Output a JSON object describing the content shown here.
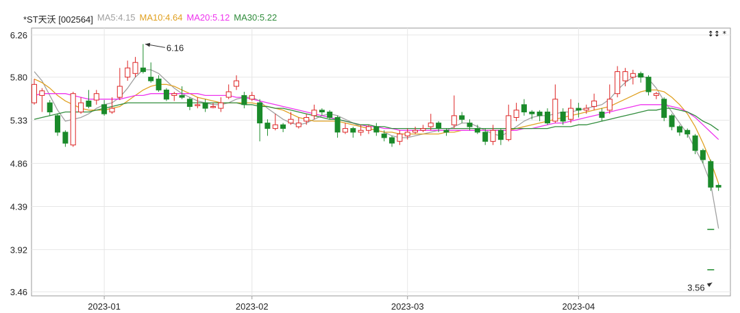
{
  "chart_data": {
    "type": "candlestick",
    "legend": [
      {
        "key": "title",
        "text": "*ST天沃 [002564]",
        "color": "#222222"
      },
      {
        "key": "ma5",
        "text": "MA5:4.15",
        "color": "#a0a0a0"
      },
      {
        "key": "ma10",
        "text": "MA10:4.64",
        "color": "#e0a020"
      },
      {
        "key": "ma20",
        "text": "MA20:5.12",
        "color": "#ee33ee"
      },
      {
        "key": "ma30",
        "text": "MA30:5.22",
        "color": "#2e8b3a"
      }
    ],
    "y_ticks": [
      "6.26",
      "5.80",
      "5.33",
      "4.86",
      "4.39",
      "3.92",
      "3.46"
    ],
    "ylim": [
      3.46,
      6.26
    ],
    "x_ticks": [
      {
        "label": "2023-01",
        "index": 9
      },
      {
        "label": "2023-02",
        "index": 28
      },
      {
        "label": "2023-03",
        "index": 48
      },
      {
        "label": "2023-04",
        "index": 70
      }
    ],
    "annotations": [
      {
        "text": "6.16",
        "index": 14,
        "value": 6.16
      },
      {
        "text": "3.56",
        "index": 87,
        "value": 3.56
      }
    ],
    "colors": {
      "up": "#dd2222",
      "down": "#1a8a2a",
      "grid": "#e6e6e6",
      "axis": "#999999"
    },
    "candles": [
      [
        5.52,
        5.72,
        5.78,
        5.5
      ],
      [
        5.6,
        5.65,
        5.68,
        5.42
      ],
      [
        5.52,
        5.42,
        5.55,
        5.38
      ],
      [
        5.38,
        5.2,
        5.4,
        5.16
      ],
      [
        5.2,
        5.08,
        5.22,
        5.04
      ],
      [
        5.06,
        5.62,
        5.64,
        5.04
      ],
      [
        5.42,
        5.52,
        5.58,
        5.4
      ],
      [
        5.54,
        5.48,
        5.66,
        5.46
      ],
      [
        5.55,
        5.62,
        5.66,
        5.5
      ],
      [
        5.5,
        5.4,
        5.55,
        5.38
      ],
      [
        5.42,
        5.46,
        5.58,
        5.4
      ],
      [
        5.58,
        5.7,
        5.9,
        5.55
      ],
      [
        5.8,
        5.9,
        5.98,
        5.76
      ],
      [
        5.84,
        5.96,
        6.02,
        5.8
      ],
      [
        5.9,
        5.86,
        6.16,
        5.84
      ],
      [
        5.8,
        5.76,
        5.96,
        5.74
      ],
      [
        5.78,
        5.66,
        5.82,
        5.64
      ],
      [
        5.66,
        5.56,
        5.68,
        5.54
      ],
      [
        5.6,
        5.62,
        5.64,
        5.54
      ],
      [
        5.6,
        5.58,
        5.7,
        5.56
      ],
      [
        5.56,
        5.48,
        5.58,
        5.44
      ],
      [
        5.5,
        5.5,
        5.58,
        5.46
      ],
      [
        5.52,
        5.46,
        5.56,
        5.42
      ],
      [
        5.48,
        5.48,
        5.52,
        5.46
      ],
      [
        5.46,
        5.52,
        5.58,
        5.42
      ],
      [
        5.58,
        5.64,
        5.72,
        5.56
      ],
      [
        5.7,
        5.76,
        5.82,
        5.66
      ],
      [
        5.6,
        5.5,
        5.64,
        5.46
      ],
      [
        5.56,
        5.6,
        5.64,
        5.54
      ],
      [
        5.52,
        5.3,
        5.56,
        5.1
      ],
      [
        5.3,
        5.24,
        5.34,
        5.16
      ],
      [
        5.24,
        5.28,
        5.4,
        5.22
      ],
      [
        5.28,
        5.24,
        5.3,
        5.2
      ],
      [
        5.3,
        5.34,
        5.42,
        5.28
      ],
      [
        5.26,
        5.3,
        5.36,
        5.24
      ],
      [
        5.32,
        5.36,
        5.4,
        5.28
      ],
      [
        5.38,
        5.44,
        5.5,
        5.34
      ],
      [
        5.44,
        5.42,
        5.46,
        5.38
      ],
      [
        5.42,
        5.36,
        5.44,
        5.34
      ],
      [
        5.36,
        5.2,
        5.38,
        5.14
      ],
      [
        5.2,
        5.24,
        5.3,
        5.18
      ],
      [
        5.24,
        5.2,
        5.26,
        5.14
      ],
      [
        5.2,
        5.22,
        5.28,
        5.16
      ],
      [
        5.22,
        5.26,
        5.28,
        5.18
      ],
      [
        5.26,
        5.2,
        5.3,
        5.16
      ],
      [
        5.18,
        5.14,
        5.22,
        5.1
      ],
      [
        5.14,
        5.08,
        5.16,
        5.04
      ],
      [
        5.1,
        5.18,
        5.22,
        5.06
      ],
      [
        5.16,
        5.2,
        5.24,
        5.12
      ],
      [
        5.2,
        5.22,
        5.26,
        5.18
      ],
      [
        5.22,
        5.24,
        5.28,
        5.2
      ],
      [
        5.26,
        5.3,
        5.4,
        5.22
      ],
      [
        5.3,
        5.24,
        5.32,
        5.2
      ],
      [
        5.22,
        5.2,
        5.24,
        5.16
      ],
      [
        5.28,
        5.38,
        5.6,
        5.24
      ],
      [
        5.38,
        5.34,
        5.42,
        5.3
      ],
      [
        5.3,
        5.26,
        5.34,
        5.22
      ],
      [
        5.24,
        5.2,
        5.28,
        5.18
      ],
      [
        5.2,
        5.1,
        5.24,
        5.06
      ],
      [
        5.1,
        5.22,
        5.28,
        5.06
      ],
      [
        5.22,
        5.12,
        5.24,
        5.06
      ],
      [
        5.12,
        5.38,
        5.5,
        5.1
      ],
      [
        5.36,
        5.44,
        5.52,
        5.32
      ],
      [
        5.5,
        5.42,
        5.56,
        5.38
      ],
      [
        5.42,
        5.4,
        5.44,
        5.34
      ],
      [
        5.42,
        5.38,
        5.44,
        5.32
      ],
      [
        5.42,
        5.3,
        5.46,
        5.28
      ],
      [
        5.32,
        5.56,
        5.72,
        5.3
      ],
      [
        5.42,
        5.32,
        5.46,
        5.28
      ],
      [
        5.34,
        5.46,
        5.56,
        5.3
      ],
      [
        5.46,
        5.44,
        5.52,
        5.36
      ],
      [
        5.44,
        5.46,
        5.5,
        5.4
      ],
      [
        5.48,
        5.54,
        5.62,
        5.44
      ],
      [
        5.42,
        5.36,
        5.46,
        5.32
      ],
      [
        5.44,
        5.56,
        5.72,
        5.4
      ],
      [
        5.62,
        5.86,
        5.92,
        5.58
      ],
      [
        5.76,
        5.86,
        5.9,
        5.7
      ],
      [
        5.8,
        5.84,
        5.88,
        5.72
      ],
      [
        5.84,
        5.8,
        5.86,
        5.74
      ],
      [
        5.8,
        5.64,
        5.82,
        5.6
      ],
      [
        5.6,
        5.62,
        5.64,
        5.56
      ],
      [
        5.56,
        5.36,
        5.58,
        5.32
      ],
      [
        5.38,
        5.26,
        5.4,
        5.22
      ],
      [
        5.26,
        5.2,
        5.28,
        5.16
      ],
      [
        5.22,
        5.18,
        5.24,
        5.14
      ],
      [
        5.16,
        5.0,
        5.18,
        4.96
      ],
      [
        5.0,
        4.9,
        5.02,
        4.86
      ],
      [
        4.88,
        4.6,
        4.9,
        4.56
      ],
      [
        4.62,
        4.6,
        4.64,
        4.56
      ]
    ],
    "trailing_marks": [
      {
        "index": 87,
        "value": 4.14
      },
      {
        "index": 87,
        "value": 3.7
      }
    ],
    "ma": {
      "ma5": [
        5.86,
        5.76,
        5.6,
        5.44,
        5.32,
        5.34,
        5.36,
        5.4,
        5.46,
        5.5,
        5.52,
        5.58,
        5.68,
        5.8,
        5.88,
        5.88,
        5.84,
        5.76,
        5.68,
        5.62,
        5.58,
        5.54,
        5.52,
        5.5,
        5.5,
        5.52,
        5.56,
        5.58,
        5.58,
        5.54,
        5.46,
        5.4,
        5.34,
        5.3,
        5.28,
        5.3,
        5.34,
        5.38,
        5.4,
        5.38,
        5.34,
        5.3,
        5.26,
        5.24,
        5.22,
        5.2,
        5.16,
        5.14,
        5.14,
        5.16,
        5.18,
        5.2,
        5.22,
        5.22,
        5.26,
        5.3,
        5.3,
        5.26,
        5.22,
        5.18,
        5.16,
        5.2,
        5.26,
        5.32,
        5.36,
        5.38,
        5.38,
        5.4,
        5.42,
        5.42,
        5.44,
        5.46,
        5.48,
        5.5,
        5.56,
        5.66,
        5.74,
        5.8,
        5.82,
        5.78,
        5.68,
        5.54,
        5.42,
        5.3,
        5.18,
        5.02,
        4.86,
        4.64,
        4.15
      ],
      "ma10": [
        5.78,
        5.74,
        5.68,
        5.6,
        5.54,
        5.5,
        5.46,
        5.44,
        5.44,
        5.44,
        5.46,
        5.48,
        5.54,
        5.6,
        5.66,
        5.7,
        5.72,
        5.72,
        5.7,
        5.66,
        5.62,
        5.58,
        5.56,
        5.54,
        5.52,
        5.52,
        5.52,
        5.52,
        5.52,
        5.5,
        5.48,
        5.46,
        5.44,
        5.4,
        5.36,
        5.34,
        5.32,
        5.32,
        5.32,
        5.32,
        5.3,
        5.28,
        5.26,
        5.24,
        5.22,
        5.2,
        5.2,
        5.18,
        5.18,
        5.18,
        5.18,
        5.18,
        5.18,
        5.2,
        5.2,
        5.22,
        5.22,
        5.22,
        5.22,
        5.22,
        5.22,
        5.22,
        5.24,
        5.26,
        5.28,
        5.3,
        5.32,
        5.34,
        5.36,
        5.38,
        5.4,
        5.42,
        5.44,
        5.46,
        5.48,
        5.52,
        5.56,
        5.6,
        5.64,
        5.66,
        5.66,
        5.64,
        5.58,
        5.5,
        5.4,
        5.26,
        5.08,
        4.88,
        4.64
      ],
      "ma20": [
        5.6,
        5.62,
        5.62,
        5.62,
        5.62,
        5.6,
        5.58,
        5.56,
        5.56,
        5.56,
        5.56,
        5.56,
        5.58,
        5.6,
        5.6,
        5.62,
        5.62,
        5.62,
        5.62,
        5.62,
        5.62,
        5.62,
        5.6,
        5.6,
        5.6,
        5.6,
        5.58,
        5.58,
        5.56,
        5.54,
        5.52,
        5.5,
        5.48,
        5.46,
        5.44,
        5.42,
        5.4,
        5.38,
        5.36,
        5.34,
        5.32,
        5.3,
        5.28,
        5.26,
        5.26,
        5.24,
        5.24,
        5.22,
        5.22,
        5.22,
        5.22,
        5.22,
        5.22,
        5.22,
        5.22,
        5.22,
        5.22,
        5.22,
        5.22,
        5.22,
        5.22,
        5.22,
        5.22,
        5.24,
        5.24,
        5.26,
        5.28,
        5.3,
        5.3,
        5.32,
        5.34,
        5.36,
        5.38,
        5.4,
        5.42,
        5.44,
        5.46,
        5.48,
        5.5,
        5.5,
        5.5,
        5.5,
        5.48,
        5.46,
        5.42,
        5.36,
        5.28,
        5.2,
        5.12
      ],
      "ma30": [
        5.34,
        5.36,
        5.38,
        5.4,
        5.42,
        5.42,
        5.42,
        5.42,
        5.44,
        5.46,
        5.48,
        5.5,
        5.52,
        5.52,
        5.52,
        5.52,
        5.52,
        5.52,
        5.52,
        5.52,
        5.52,
        5.52,
        5.52,
        5.52,
        5.52,
        5.52,
        5.52,
        5.5,
        5.5,
        5.48,
        5.48,
        5.46,
        5.46,
        5.44,
        5.42,
        5.4,
        5.38,
        5.36,
        5.34,
        5.34,
        5.32,
        5.3,
        5.28,
        5.28,
        5.26,
        5.26,
        5.24,
        5.24,
        5.24,
        5.24,
        5.24,
        5.24,
        5.24,
        5.24,
        5.24,
        5.24,
        5.24,
        5.24,
        5.24,
        5.24,
        5.24,
        5.24,
        5.24,
        5.24,
        5.24,
        5.24,
        5.24,
        5.26,
        5.26,
        5.26,
        5.28,
        5.28,
        5.3,
        5.32,
        5.34,
        5.36,
        5.38,
        5.4,
        5.42,
        5.44,
        5.44,
        5.46,
        5.46,
        5.44,
        5.42,
        5.38,
        5.32,
        5.28,
        5.22
      ]
    }
  }
}
